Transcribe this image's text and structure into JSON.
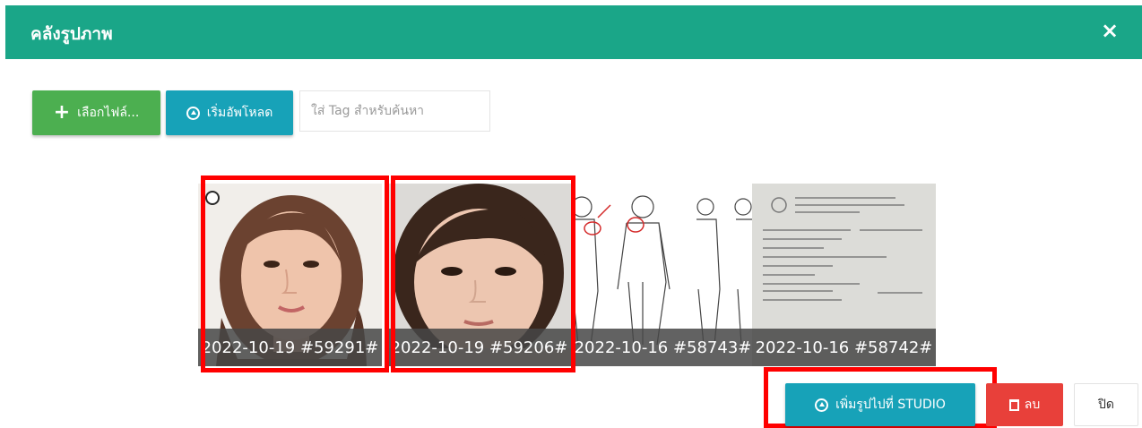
{
  "modal": {
    "title": "คลังรูปภาพ",
    "close_symbol": "×"
  },
  "toolbar": {
    "choose_files_label": "เลือกไฟล์...",
    "start_upload_label": "เริ่มอัพโหลด",
    "tag_placeholder": "ใส่ Tag สำหรับค้นหา"
  },
  "gallery": {
    "items": [
      {
        "caption": "2022-10-19 #59291#",
        "content": "face-photo",
        "selected": true
      },
      {
        "caption": "2022-10-19 #59206#",
        "content": "face-photo",
        "selected": true
      },
      {
        "caption": "2022-10-16 #58743#",
        "content": "body-chart-drawing",
        "selected": false
      },
      {
        "caption": "2022-10-16 #58742#",
        "content": "document-scan",
        "selected": false
      }
    ]
  },
  "footer": {
    "add_to_studio_label": "เพิ่มรูปไปที่ STUDIO",
    "delete_label": "ลบ",
    "close_label": "ปิด"
  },
  "colors": {
    "header": "#1aa688",
    "green_button": "#4caf50",
    "teal_button": "#17a2b8",
    "delete_button": "#e8403a",
    "highlight": "#ff0000"
  },
  "icons": [
    "plus-icon",
    "upload-circle-icon",
    "trash-icon",
    "close-icon",
    "radio-circle-icon"
  ]
}
